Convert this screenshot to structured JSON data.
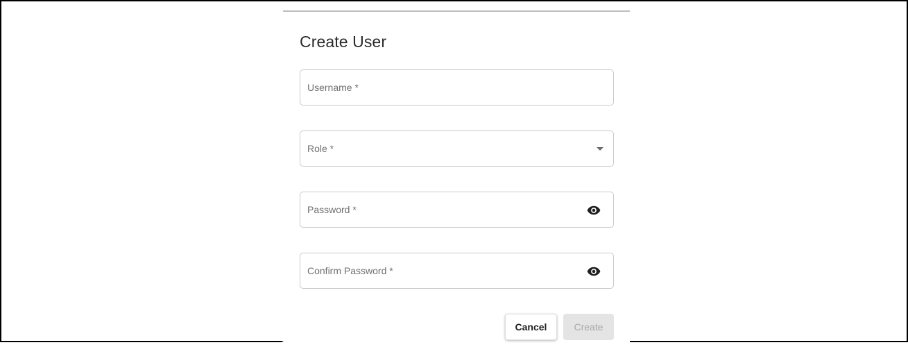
{
  "dialog": {
    "title": "Create User",
    "fields": [
      {
        "label": "Username *",
        "value": "",
        "type": "text"
      },
      {
        "label": "Role *",
        "value": "",
        "type": "select",
        "icon": "dropdown-arrow-icon"
      },
      {
        "label": "Password *",
        "value": "",
        "type": "password",
        "icon": "eye-icon"
      },
      {
        "label": "Confirm Password *",
        "value": "",
        "type": "password",
        "icon": "eye-icon"
      }
    ],
    "buttons": {
      "cancel_label": "Cancel",
      "create_label": "Create",
      "create_disabled": true
    }
  },
  "colors": {
    "field_border": "#c9c9c9",
    "label": "#6f6f6f",
    "disabled_button_bg": "#e4e4e4",
    "disabled_button_text": "#a9a9a9",
    "icon": "#1f1f1f"
  }
}
